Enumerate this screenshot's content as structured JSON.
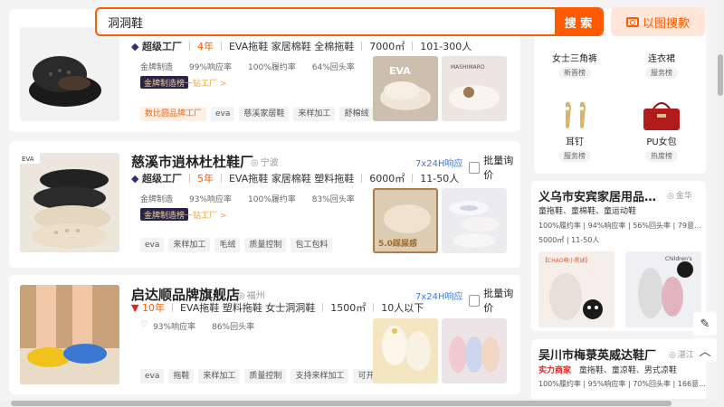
{
  "search": {
    "query": "洞洞鞋",
    "button": "搜 索",
    "image_search": "以图搜款"
  },
  "card1": {
    "level": "超级工厂",
    "years": "4年",
    "products": "EVA拖鞋 家居棉鞋 全棉拖鞋",
    "area": "7000㎡",
    "staff": "101-300人",
    "stats": [
      "金牌制造",
      "99%响应率",
      "100%履约率",
      "64%回头率"
    ],
    "gold_badge": "金牌制造榜",
    "gold_link": "一钻工厂 >",
    "tags": [
      "数比圆品牌工厂",
      "eva",
      "慈溪家居鞋",
      "来样加工",
      "舒棉绒"
    ],
    "thumb1_text": "EVA",
    "thumb2_text": "MASHIMARO"
  },
  "card2": {
    "title": "慈溪市逍林杜杜鞋厂",
    "location": "宁波",
    "service": "7x24H响应",
    "inquiry": "批量询价",
    "level": "超级工厂",
    "years": "5年",
    "products": "EVA拖鞋 家居棉鞋 塑料拖鞋",
    "area": "6000㎡",
    "staff": "11-50人",
    "stats": [
      "金牌制造",
      "93%响应率",
      "100%履约率",
      "83%回头率"
    ],
    "gold_badge": "金牌制造榜",
    "gold_link": "一钻工厂 >",
    "tags": [
      "eva",
      "来样加工",
      "毛绒",
      "质量控制",
      "包工包料"
    ],
    "photo_label": "EVA",
    "thumb1_text": "5.0踩屎感"
  },
  "card3": {
    "title": "启达顺品牌旗舰店",
    "location": "福州",
    "service": "7x24H响应",
    "inquiry": "批量询价",
    "years": "10年",
    "products": "EVA拖鞋 塑料拖鞋 女士洞洞鞋",
    "area": "1500㎡",
    "staff": "10人以下",
    "stats": [
      "93%响应率",
      "86%回头率"
    ],
    "tags": [
      "eva",
      "拖鞋",
      "来样加工",
      "质量控制",
      "支持来样加工",
      "可开专票"
    ]
  },
  "rank": {
    "items": [
      {
        "name": "女士三角裤",
        "pill": "新晋榜"
      },
      {
        "name": "连衣裙",
        "pill": "服务榜"
      },
      {
        "name": "耳钉",
        "pill": "服务榜"
      },
      {
        "name": "PU女包",
        "pill": "热度榜"
      }
    ]
  },
  "rcard1": {
    "title": "义乌市安宾家居用品…",
    "location": "金华",
    "products": "童拖鞋、童棉鞋、童运动鞋",
    "stats": "100%履约率 | 94%响应率 | 56%回头率 | 79意…",
    "area_staff": "5000㎡ | 11-50人",
    "thumb_text": "【CHAO萌小黑球】",
    "thumb2_text": "Children's"
  },
  "rcard2": {
    "title": "吴川市梅菉英威达鞋厂",
    "location": "湛江",
    "badge": "实力商家",
    "products": "童拖鞋、童凉鞋、男式凉鞋",
    "stats": "100%履约率 | 95%响应率 | 70%回头率 | 166意…"
  },
  "colors": {
    "accent": "#ff5a00",
    "service_blue": "#3b7ad9",
    "gold_badge_bg": "#2a2247"
  },
  "icons": [
    "camera-icon",
    "location-icon",
    "diamond-icon",
    "checkbox-icon",
    "edit-icon",
    "chevron-up-icon"
  ]
}
